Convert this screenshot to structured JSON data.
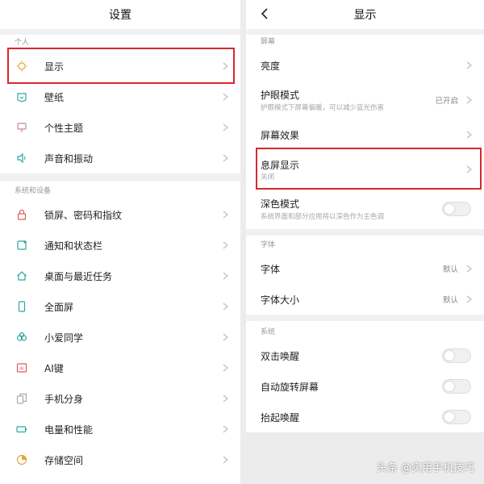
{
  "left": {
    "title": "设置",
    "sections": [
      {
        "label": "个人",
        "items": [
          {
            "label": "显示",
            "icon": "sun-icon"
          },
          {
            "label": "壁纸",
            "icon": "wallpaper-icon"
          },
          {
            "label": "个性主题",
            "icon": "theme-icon"
          },
          {
            "label": "声音和振动",
            "icon": "speaker-icon"
          }
        ]
      },
      {
        "label": "系统和设备",
        "items": [
          {
            "label": "锁屏、密码和指纹",
            "icon": "lock-icon"
          },
          {
            "label": "通知和状态栏",
            "icon": "notification-icon"
          },
          {
            "label": "桌面与最近任务",
            "icon": "home-icon"
          },
          {
            "label": "全面屏",
            "icon": "phone-icon"
          },
          {
            "label": "小爱同学",
            "icon": "xiaoai-icon"
          },
          {
            "label": "AI键",
            "icon": "ai-key-icon"
          },
          {
            "label": "手机分身",
            "icon": "dual-space-icon"
          },
          {
            "label": "电量和性能",
            "icon": "battery-icon"
          },
          {
            "label": "存储空间",
            "icon": "storage-icon"
          }
        ]
      }
    ]
  },
  "right": {
    "title": "显示",
    "sections": [
      {
        "label": "屏幕",
        "items": [
          {
            "label": "亮度",
            "sub": "",
            "value": "",
            "control": "chevron"
          },
          {
            "label": "护眼模式",
            "sub": "护眼模式下屏幕偏暖，可以减少蓝光伤害",
            "value": "已开启",
            "control": "chevron"
          },
          {
            "label": "屏幕效果",
            "sub": "",
            "value": "",
            "control": "chevron"
          },
          {
            "label": "息屏显示",
            "sub": "关闭",
            "value": "",
            "control": "chevron"
          },
          {
            "label": "深色模式",
            "sub": "系统界面和部分应用将以深色作为主色调",
            "value": "",
            "control": "toggle",
            "on": false
          }
        ]
      },
      {
        "label": "字体",
        "items": [
          {
            "label": "字体",
            "sub": "",
            "value": "默认",
            "control": "chevron"
          },
          {
            "label": "字体大小",
            "sub": "",
            "value": "默认",
            "control": "chevron"
          }
        ]
      },
      {
        "label": "系统",
        "items": [
          {
            "label": "双击唤醒",
            "control": "toggle",
            "on": false
          },
          {
            "label": "自动旋转屏幕",
            "control": "toggle",
            "on": false
          },
          {
            "label": "抬起唤醒",
            "control": "toggle",
            "on": false
          }
        ]
      }
    ]
  },
  "highlights": [
    "显示",
    "息屏显示"
  ],
  "watermark": "头条 @实用手机技巧",
  "colors": {
    "accent": "#2ba6a0",
    "highlight": "#d6282e",
    "divider": "#f1f1f1"
  }
}
